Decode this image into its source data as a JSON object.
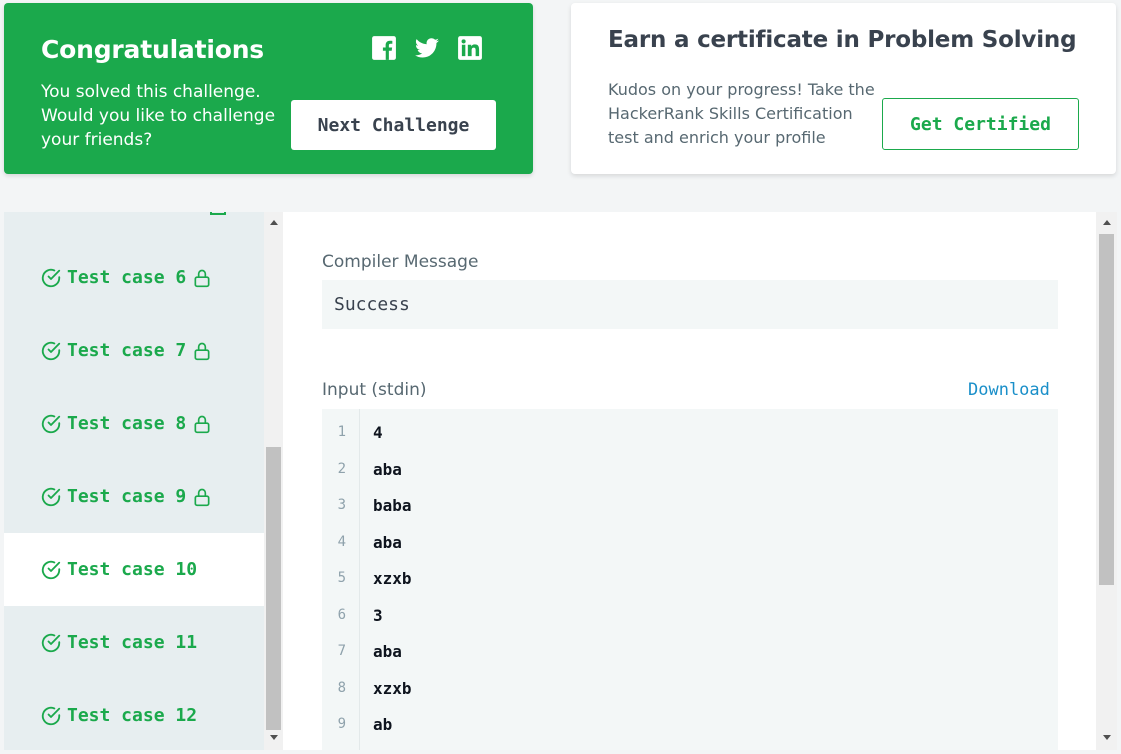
{
  "congrats": {
    "title": "Congratulations",
    "message": "You solved this challenge. Would you like to challenge your friends?",
    "next_label": "Next Challenge",
    "social": [
      "facebook-icon",
      "twitter-icon",
      "linkedin-icon"
    ]
  },
  "certificate": {
    "title": "Earn a certificate in Problem Solving",
    "message": "Kudos on your progress! Take the HackerRank Skills Certification test and enrich your profile",
    "button_label": "Get Certified"
  },
  "testcases": {
    "items": [
      {
        "label": "Test case 6",
        "locked": true,
        "active": false
      },
      {
        "label": "Test case 7",
        "locked": true,
        "active": false
      },
      {
        "label": "Test case 8",
        "locked": true,
        "active": false
      },
      {
        "label": "Test case 9",
        "locked": true,
        "active": false
      },
      {
        "label": "Test case 10",
        "locked": false,
        "active": true
      },
      {
        "label": "Test case 11",
        "locked": false,
        "active": false
      },
      {
        "label": "Test case 12",
        "locked": false,
        "active": false
      }
    ]
  },
  "result": {
    "compiler_label": "Compiler Message",
    "compiler_value": "Success",
    "input_label": "Input (stdin)",
    "download_label": "Download",
    "input_lines": [
      {
        "n": "1",
        "v": "4"
      },
      {
        "n": "2",
        "v": "aba"
      },
      {
        "n": "3",
        "v": "baba"
      },
      {
        "n": "4",
        "v": "aba"
      },
      {
        "n": "5",
        "v": "xzxb"
      },
      {
        "n": "6",
        "v": "3"
      },
      {
        "n": "7",
        "v": "aba"
      },
      {
        "n": "8",
        "v": "xzxb"
      },
      {
        "n": "9",
        "v": "ab"
      }
    ]
  },
  "colors": {
    "accent": "#1ba94c",
    "link": "#1a8fc9",
    "text_dark": "#39424e",
    "sidebar_bg": "#e7eef0"
  }
}
